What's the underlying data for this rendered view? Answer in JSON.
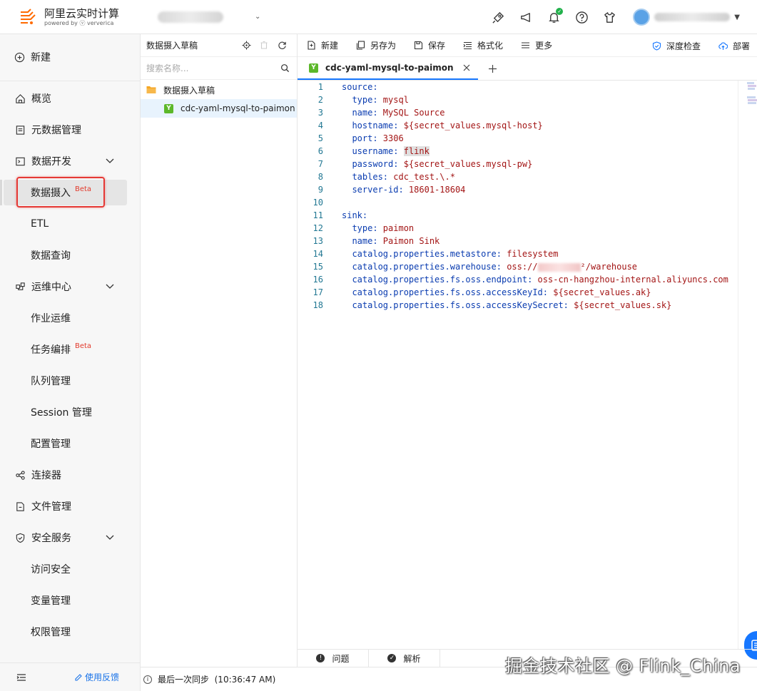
{
  "header": {
    "app_title": "阿里云实时计算",
    "app_subtitle": "powered by ⓥ ververica"
  },
  "sidebar": {
    "new_label": "新建",
    "items": {
      "overview": "概览",
      "metadata": "元数据管理",
      "dev": "数据开发",
      "ingest": "数据摄入",
      "ingest_badge": "Beta",
      "etl": "ETL",
      "query": "数据查询",
      "ops": "运维中心",
      "job_ops": "作业运维",
      "task_orch": "任务编排",
      "task_orch_badge": "Beta",
      "queue": "队列管理",
      "session": "Session 管理",
      "config": "配置管理",
      "connectors": "连接器",
      "files": "文件管理",
      "security": "安全服务",
      "access": "访问安全",
      "variables": "变量管理",
      "permissions": "权限管理"
    },
    "feedback": "使用反馈"
  },
  "drafts": {
    "title": "数据摄入草稿",
    "search_placeholder": "搜索名称...",
    "folder": "数据摄入草稿",
    "file": "cdc-yaml-mysql-to-paimon"
  },
  "toolbar": {
    "new": "新建",
    "save_as": "另存为",
    "save": "保存",
    "format": "格式化",
    "more": "更多",
    "deep_check": "深度检查",
    "deploy": "部署"
  },
  "editor": {
    "tab_label": "cdc-yaml-mysql-to-paimon",
    "tab_badge": "Y",
    "lines": [
      {
        "n": "1",
        "k": "source:",
        "v": "",
        "top": true
      },
      {
        "n": "2",
        "k": "type:",
        "v": " mysql"
      },
      {
        "n": "3",
        "k": "name:",
        "v": " MySQL Source"
      },
      {
        "n": "4",
        "k": "hostname:",
        "v": " ${secret_values.mysql-host}"
      },
      {
        "n": "5",
        "k": "port:",
        "v": " 3306"
      },
      {
        "n": "6",
        "k": "username:",
        "v": "flink"
      },
      {
        "n": "7",
        "k": "password:",
        "v": " ${secret_values.mysql-pw}"
      },
      {
        "n": "8",
        "k": "tables:",
        "v": " cdc_test.\\.*"
      },
      {
        "n": "9",
        "k": "server-id:",
        "v": " 18601-18604"
      },
      {
        "n": "10",
        "k": "",
        "v": ""
      },
      {
        "n": "11",
        "k": "sink:",
        "v": "",
        "top": true
      },
      {
        "n": "12",
        "k": "type:",
        "v": " paimon"
      },
      {
        "n": "13",
        "k": "name:",
        "v": " Paimon Sink"
      },
      {
        "n": "14",
        "k": "catalog.properties.metastore:",
        "v": " filesystem"
      },
      {
        "n": "15",
        "k": "catalog.properties.warehouse:",
        "v": " oss://",
        "v2": "²/warehouse"
      },
      {
        "n": "16",
        "k": "catalog.properties.fs.oss.endpoint:",
        "v": " oss-cn-hangzhou-internal.aliyuncs.com"
      },
      {
        "n": "17",
        "k": "catalog.properties.fs.oss.accessKeyId:",
        "v": " ${secret_values.ak}"
      },
      {
        "n": "18",
        "k": "catalog.properties.fs.oss.accessKeySecret:",
        "v": " ${secret_values.sk}"
      }
    ]
  },
  "bottom": {
    "problems": "问题",
    "parse": "解析",
    "last_sync": "最后一次同步  (10:36:47 AM)"
  },
  "watermark": "掘金技术社区 @ Flink_China",
  "colors": {
    "accent": "#1677ff",
    "highlight_red": "#e53935",
    "yaml_badge": "#5cb82a"
  }
}
